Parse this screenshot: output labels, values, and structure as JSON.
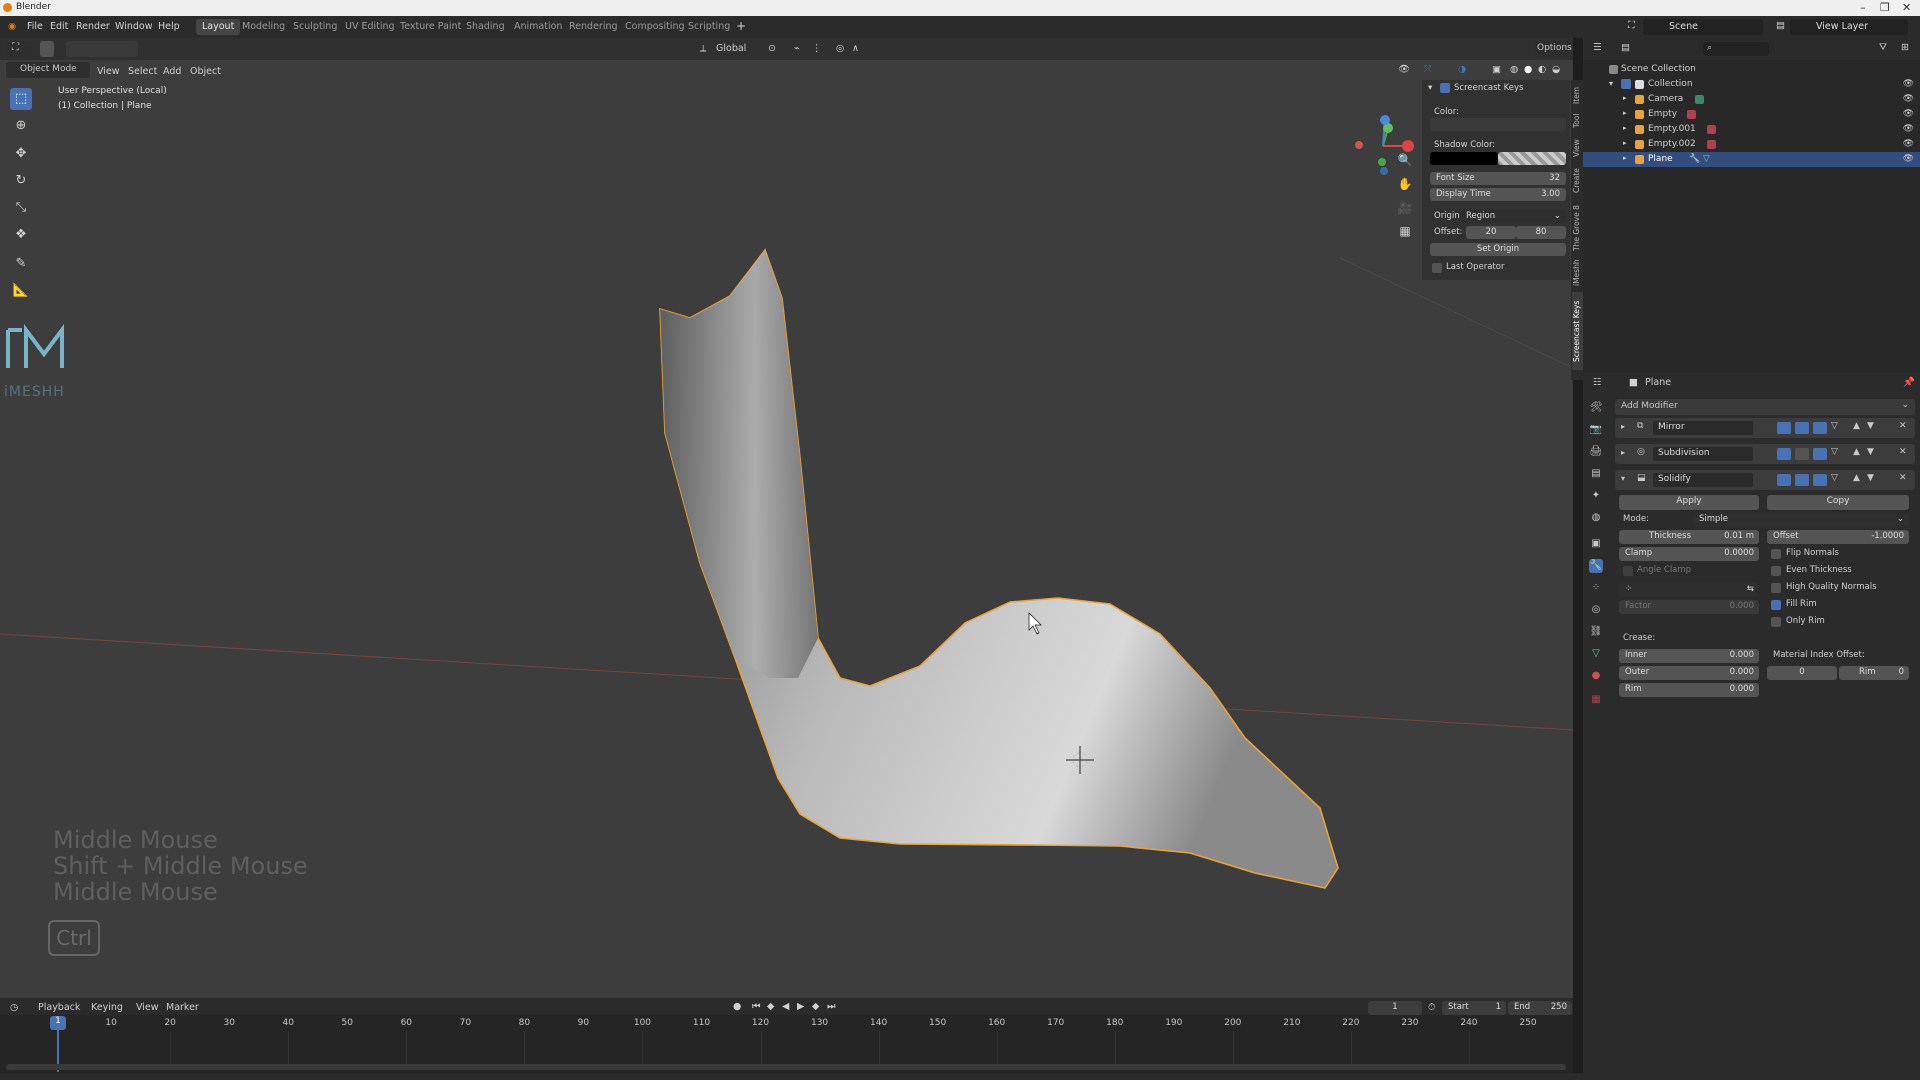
{
  "titlebar": {
    "title": "Blender",
    "min": "–",
    "max": "❐",
    "close": "✕"
  },
  "menu": {
    "items": [
      "File",
      "Edit",
      "Render",
      "Window",
      "Help"
    ]
  },
  "workspaces": [
    "Layout",
    "Modeling",
    "Sculpting",
    "UV Editing",
    "Texture Paint",
    "Shading",
    "Animation",
    "Rendering",
    "Compositing",
    "Scripting"
  ],
  "topright": {
    "scene": "Scene",
    "view_layer": "View Layer"
  },
  "viewport": {
    "mode": "Object Mode",
    "menus": [
      "View",
      "Select",
      "Add",
      "Object"
    ],
    "transform_orientation": "Global",
    "options": "Options",
    "perspective": "User Perspective (Local)",
    "collection_info": "(1) Collection | Plane",
    "screencast_keys": [
      "Middle Mouse",
      "Shift + Middle Mouse",
      "Middle Mouse"
    ],
    "key_hold": "Ctrl",
    "logo_text": "iMESHH"
  },
  "npanel": {
    "title": "Screencast Keys",
    "color_label": "Color:",
    "shadow_color_label": "Shadow Color:",
    "font_size_label": "Font Size",
    "font_size": "32",
    "display_time_label": "Display Time",
    "display_time": "3.00",
    "origin_label": "Origin:",
    "origin_value": "Region",
    "offset_label": "Offset:",
    "offset_x": "20",
    "offset_y": "80",
    "set_origin": "Set Origin",
    "last_operator": "Last Operator",
    "tabs": [
      "Item",
      "Tool",
      "View",
      "Create",
      "The Grove 8",
      "iMeshh",
      "Screencast Keys"
    ]
  },
  "timeline": {
    "menus": [
      "Playback",
      "Keying",
      "View",
      "Marker"
    ],
    "current_frame": "1",
    "start_label": "Start",
    "start": "1",
    "end_label": "End",
    "end": "250",
    "ticks": [
      "10",
      "20",
      "30",
      "40",
      "50",
      "60",
      "70",
      "80",
      "90",
      "100",
      "110",
      "120",
      "130",
      "140",
      "150",
      "160",
      "170",
      "180",
      "190",
      "200",
      "210",
      "220",
      "230",
      "240",
      "250"
    ]
  },
  "outliner": {
    "root": "Scene Collection",
    "collection": "Collection",
    "items": [
      "Camera",
      "Empty",
      "Empty.001",
      "Empty.002",
      "Plane"
    ]
  },
  "properties": {
    "object_name": "Plane",
    "add_modifier": "Add Modifier",
    "modifiers": [
      "Mirror",
      "Subdivision",
      "Solidify"
    ],
    "apply": "Apply",
    "copy": "Copy",
    "mode_label": "Mode:",
    "mode_value": "Simple",
    "thickness_label": "Thickness",
    "thickness": "0.01 m",
    "offset_label": "Offset",
    "offset": "-1.0000",
    "clamp_label": "Clamp",
    "clamp": "0.0000",
    "angle_clamp": "Angle Clamp",
    "flip_normals": "Flip Normals",
    "even_thickness": "Even Thickness",
    "high_quality_normals": "High Quality Normals",
    "fill_rim": "Fill Rim",
    "only_rim": "Only Rim",
    "factor_label": "Factor",
    "factor": "0.000",
    "crease_label": "Crease:",
    "inner_label": "Inner",
    "inner": "0.000",
    "outer_label": "Outer",
    "outer": "0.000",
    "rim_label": "Rim",
    "rim": "0.000",
    "mat_index_label": "Material Index Offset:",
    "mat_index": "0",
    "mat_rim_label": "Rim",
    "mat_rim": "0"
  },
  "colors": {
    "accent": "#4772b3",
    "selection_outline": "#e8a33d",
    "viewport_bg": "#3d3d3d"
  }
}
